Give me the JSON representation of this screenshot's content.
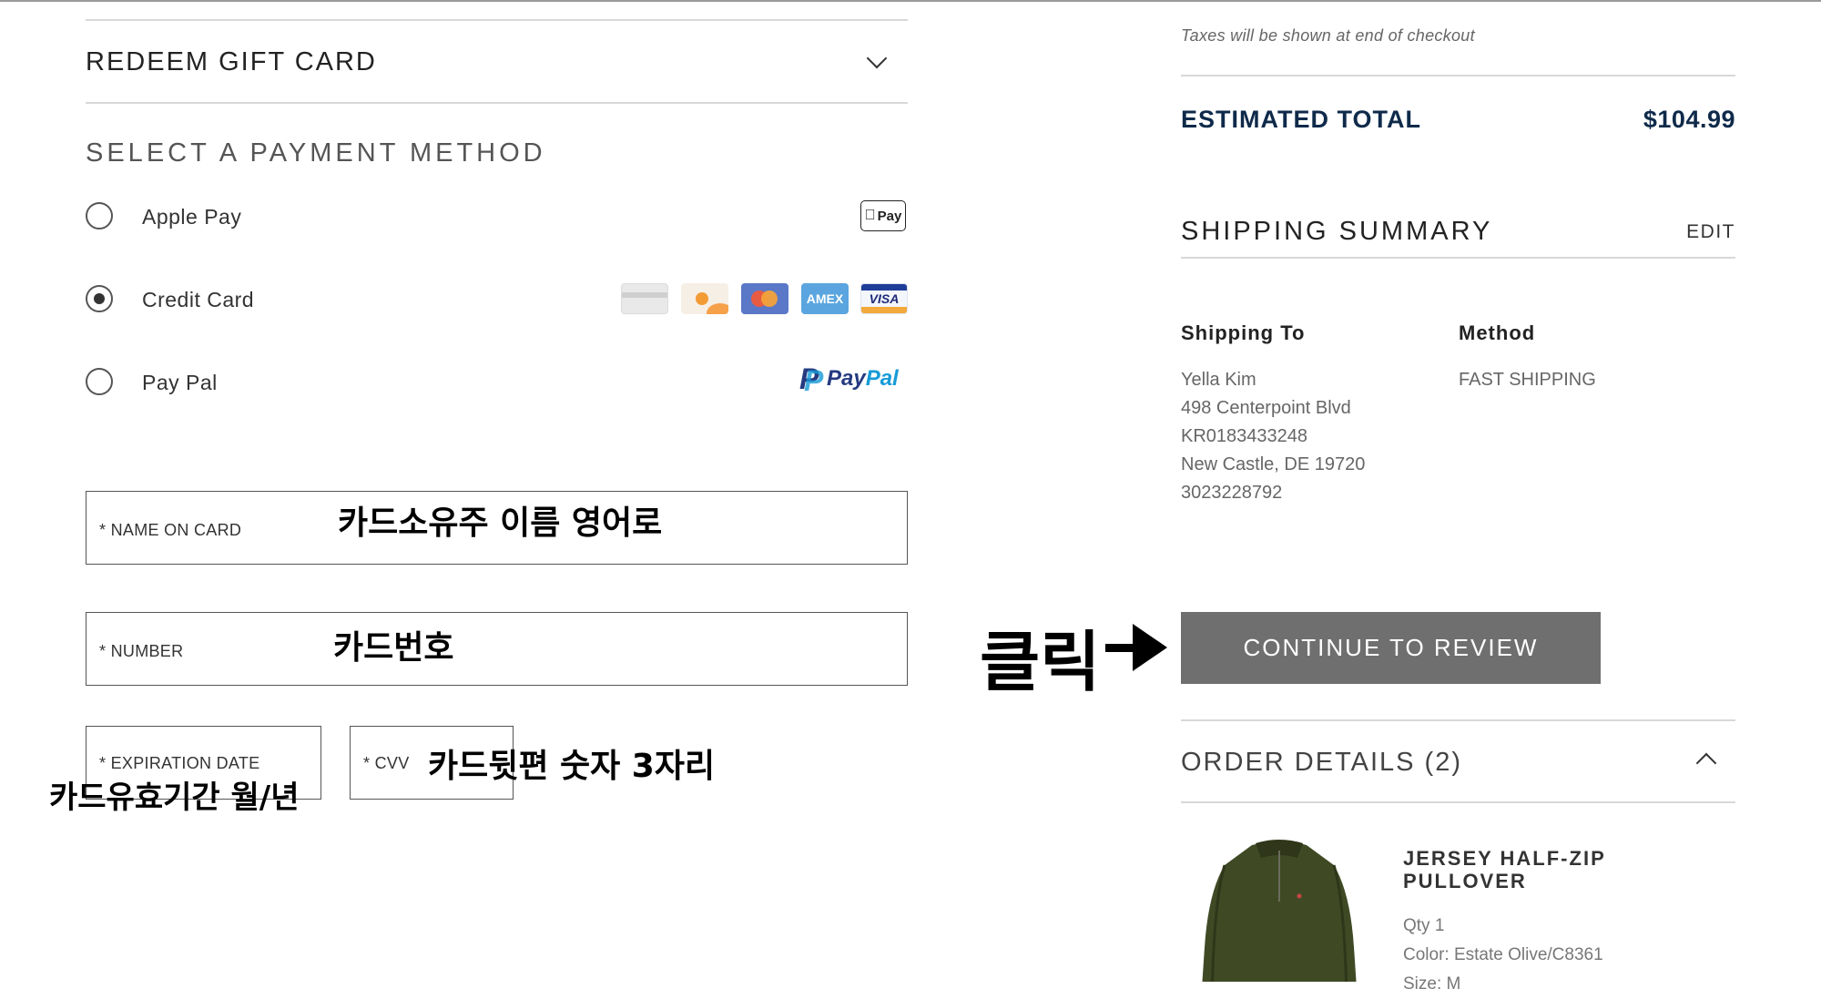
{
  "gift_card": {
    "label": "REDEEM GIFT CARD"
  },
  "payment": {
    "title": "SELECT A PAYMENT METHOD",
    "options": [
      {
        "label": "Apple Pay",
        "selected": false,
        "badge": "Pay"
      },
      {
        "label": "Credit Card",
        "selected": true
      },
      {
        "label": "Pay Pal",
        "selected": false
      }
    ],
    "card_brands": [
      "generic-card",
      "discover",
      "mastercard",
      "AMEX",
      "VISA"
    ],
    "paypal_logo": {
      "word1": "Pay",
      "word2": "Pal"
    }
  },
  "form": {
    "name_label": "* NAME ON CARD",
    "number_label": "* NUMBER",
    "expiration_label": "* EXPIRATION DATE",
    "cvv_label": "* CVV"
  },
  "annotations": {
    "name": "카드소유주 이름 영어로",
    "number": "카드번호",
    "expiration": "카드유효기간 월/년",
    "cvv": "카드뒷편 숫자 3자리",
    "click": "클릭"
  },
  "summary": {
    "tax_note": "Taxes will be shown at end of checkout",
    "estimated_total_label": "ESTIMATED TOTAL",
    "estimated_total_value": "$104.99",
    "shipping_summary_title": "SHIPPING SUMMARY",
    "edit_label": "EDIT",
    "shipping_to_label": "Shipping To",
    "method_label": "Method",
    "address_lines": [
      "Yella Kim",
      "498 Centerpoint Blvd",
      "KR0183433248",
      "New Castle, DE 19720",
      "3023228792"
    ],
    "method_value": "FAST SHIPPING",
    "continue_button": "CONTINUE TO REVIEW",
    "order_details_title": "ORDER DETAILS (2)"
  },
  "product": {
    "name_line1": "JERSEY HALF-ZIP",
    "name_line2": "PULLOVER",
    "qty": "Qty 1",
    "color": "Color: Estate Olive/C8361",
    "size": "Size: M"
  },
  "colors": {
    "total_navy": "#0f2a4a",
    "cta_gray": "#6f6f6f",
    "product_olive": "#3f4a25"
  }
}
